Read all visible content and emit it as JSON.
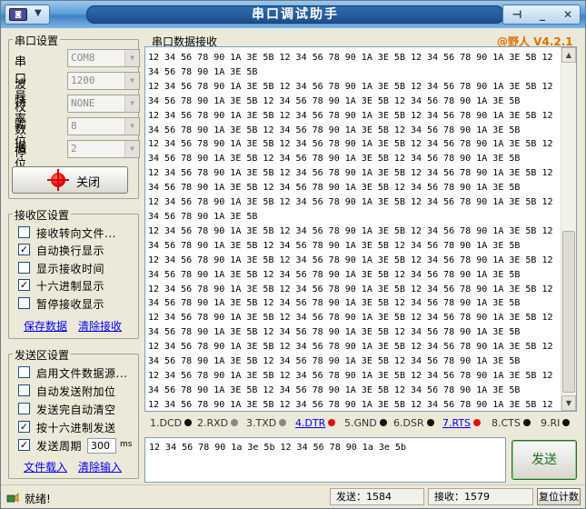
{
  "window": {
    "title": "串口调试助手",
    "brand": "@野人 V4.2.1"
  },
  "port_settings": {
    "title": "串口设置",
    "fields": [
      {
        "label": "串口号",
        "value": "COM8"
      },
      {
        "label": "波特率",
        "value": "1200"
      },
      {
        "label": "校验位",
        "value": "NONE"
      },
      {
        "label": "数据位",
        "value": "8"
      },
      {
        "label": "停止位",
        "value": "2"
      }
    ],
    "close_label": "关闭"
  },
  "receive_settings": {
    "title": "接收区设置",
    "options": [
      {
        "label": "接收转向文件...",
        "checked": false
      },
      {
        "label": "自动换行显示",
        "checked": true
      },
      {
        "label": "显示接收时间",
        "checked": false
      },
      {
        "label": "十六进制显示",
        "checked": true
      },
      {
        "label": "暂停接收显示",
        "checked": false
      }
    ],
    "save_link": "保存数据",
    "clear_link": "清除接收"
  },
  "send_settings": {
    "title": "发送区设置",
    "options": [
      {
        "label": "启用文件数据源...",
        "checked": false
      },
      {
        "label": "自动发送附加位",
        "checked": false
      },
      {
        "label": "发送完自动清空",
        "checked": false
      },
      {
        "label": "按十六进制发送",
        "checked": true
      },
      {
        "label": "发送周期",
        "checked": true
      }
    ],
    "period_value": "300",
    "period_unit": "ms",
    "load_link": "文件载入",
    "clear_link": "清除输入"
  },
  "receive_area": {
    "title": "串口数据接收",
    "lines": [
      "12 34 56 78 90 1A 3E 5B 12 34 56 78 90 1A 3E 5B 12 34 56 78 90 1A 3E 5B 12",
      "34 56 78 90 1A 3E 5B",
      "12 34 56 78 90 1A 3E 5B 12 34 56 78 90 1A 3E 5B 12 34 56 78 90 1A 3E 5B 12",
      "34 56 78 90 1A 3E 5B 12 34 56 78 90 1A 3E 5B 12 34 56 78 90 1A 3E 5B",
      "12 34 56 78 90 1A 3E 5B 12 34 56 78 90 1A 3E 5B 12 34 56 78 90 1A 3E 5B 12",
      "34 56 78 90 1A 3E 5B 12 34 56 78 90 1A 3E 5B 12 34 56 78 90 1A 3E 5B",
      "12 34 56 78 90 1A 3E 5B 12 34 56 78 90 1A 3E 5B 12 34 56 78 90 1A 3E 5B 12",
      "34 56 78 90 1A 3E 5B 12 34 56 78 90 1A 3E 5B 12 34 56 78 90 1A 3E 5B",
      "12 34 56 78 90 1A 3E 5B 12 34 56 78 90 1A 3E 5B 12 34 56 78 90 1A 3E 5B 12",
      "34 56 78 90 1A 3E 5B 12 34 56 78 90 1A 3E 5B 12 34 56 78 90 1A 3E 5B",
      "12 34 56 78 90 1A 3E 5B 12 34 56 78 90 1A 3E 5B 12 34 56 78 90 1A 3E 5B 12",
      "34 56 78 90 1A 3E 5B",
      "12 34 56 78 90 1A 3E 5B 12 34 56 78 90 1A 3E 5B 12 34 56 78 90 1A 3E 5B 12",
      "34 56 78 90 1A 3E 5B 12 34 56 78 90 1A 3E 5B 12 34 56 78 90 1A 3E 5B",
      "12 34 56 78 90 1A 3E 5B 12 34 56 78 90 1A 3E 5B 12 34 56 78 90 1A 3E 5B 12",
      "34 56 78 90 1A 3E 5B 12 34 56 78 90 1A 3E 5B 12 34 56 78 90 1A 3E 5B",
      "12 34 56 78 90 1A 3E 5B 12 34 56 78 90 1A 3E 5B 12 34 56 78 90 1A 3E 5B 12",
      "34 56 78 90 1A 3E 5B 12 34 56 78 90 1A 3E 5B 12 34 56 78 90 1A 3E 5B",
      "12 34 56 78 90 1A 3E 5B 12 34 56 78 90 1A 3E 5B 12 34 56 78 90 1A 3E 5B 12",
      "34 56 78 90 1A 3E 5B 12 34 56 78 90 1A 3E 5B 12 34 56 78 90 1A 3E 5B",
      "12 34 56 78 90 1A 3E 5B 12 34 56 78 90 1A 3E 5B 12 34 56 78 90 1A 3E 5B 12",
      "34 56 78 90 1A 3E 5B 12 34 56 78 90 1A 3E 5B 12 34 56 78 90 1A 3E 5B",
      "12 34 56 78 90 1A 3E 5B 12 34 56 78 90 1A 3E 5B 12 34 56 78 90 1A 3E 5B 12",
      "34 56 78 90 1A 3E 5B 12 34 56 78 90 1A 3E 5B 12 34 56 78 90 1A 3E 5B",
      "12 34 56 78 90 1A 3E 5B 12 34 56 78 90 1A 3E 5B 12 34 56 78 90 1A 3E 5B 12",
      "34 56 78 90 1A 3E 5B"
    ]
  },
  "signals": [
    {
      "label": "1.DCD",
      "color": "#111111",
      "link": false
    },
    {
      "label": "2.RXD",
      "color": "#888888",
      "link": false
    },
    {
      "label": "3.TXD",
      "color": "#888888",
      "link": false
    },
    {
      "label": "4.DTR",
      "color": "#e01010",
      "link": true
    },
    {
      "label": "5.GND",
      "color": "#111111",
      "link": false
    },
    {
      "label": "6.DSR",
      "color": "#111111",
      "link": false
    },
    {
      "label": "7.RTS",
      "color": "#e01010",
      "link": true
    },
    {
      "label": "8.CTS",
      "color": "#111111",
      "link": false
    },
    {
      "label": "9.RI",
      "color": "#111111",
      "link": false
    }
  ],
  "send_area": {
    "text": "12 34 56 78 90 1a 3e 5b 12 34 56 78 90 1a 3e 5b",
    "send_label": "发送"
  },
  "status": {
    "text": "就绪!",
    "sent": "发送：1584",
    "received": "接收：1579",
    "reset_label": "复位计数"
  }
}
